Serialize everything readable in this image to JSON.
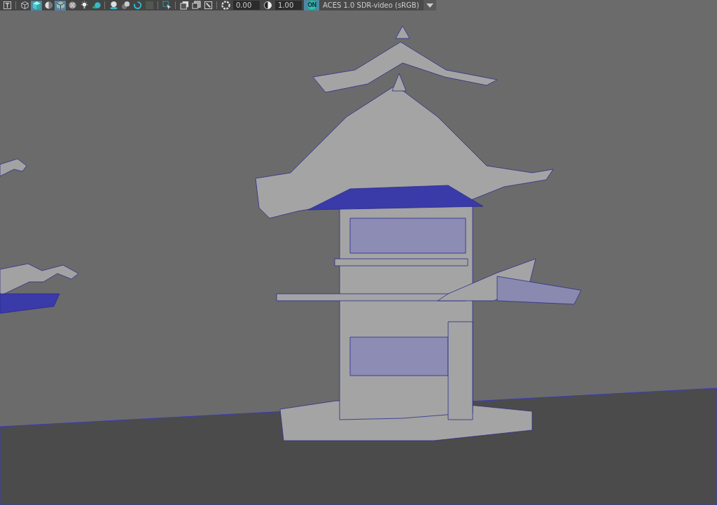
{
  "toolbar": {
    "items": [
      {
        "kind": "icon",
        "selected": false
      },
      {
        "kind": "separator"
      },
      {
        "kind": "icon",
        "selected": false
      },
      {
        "kind": "icon",
        "selected": true
      },
      {
        "kind": "icon",
        "selected": false
      },
      {
        "kind": "icon",
        "selected": true
      },
      {
        "kind": "icon",
        "selected": false
      },
      {
        "kind": "icon",
        "selected": false
      },
      {
        "kind": "icon",
        "selected": false
      },
      {
        "kind": "separator"
      },
      {
        "kind": "icon",
        "selected": false
      },
      {
        "kind": "icon",
        "selected": false
      },
      {
        "kind": "icon",
        "selected": false
      },
      {
        "kind": "icon",
        "selected": false
      },
      {
        "kind": "separator"
      },
      {
        "kind": "icon",
        "selected": false
      },
      {
        "kind": "separator"
      },
      {
        "kind": "icon",
        "selected": false
      },
      {
        "kind": "icon",
        "selected": false
      },
      {
        "kind": "icon",
        "selected": false
      },
      {
        "kind": "separator"
      },
      {
        "kind": "icon",
        "selected": false
      },
      {
        "kind": "field",
        "value": "0.00"
      },
      {
        "kind": "icon",
        "selected": false
      },
      {
        "kind": "field",
        "value": "1.00"
      },
      {
        "kind": "badge",
        "text": "ON"
      },
      {
        "kind": "dropdown",
        "value": "ACES 1.0 SDR-video (sRGB)"
      }
    ]
  }
}
